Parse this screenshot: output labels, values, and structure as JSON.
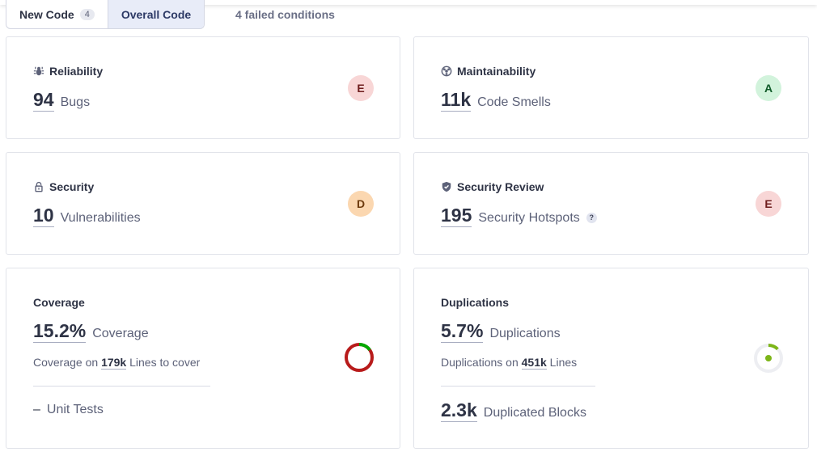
{
  "tabs": {
    "new_code_label": "New Code",
    "new_code_count": "4",
    "overall_code_label": "Overall Code",
    "active": "Overall Code"
  },
  "failed_conditions": "4 failed conditions",
  "reliability": {
    "title": "Reliability",
    "value": "94",
    "label": "Bugs",
    "grade": "E",
    "icon": "bug-icon"
  },
  "maintainability": {
    "title": "Maintainability",
    "value": "11k",
    "label": "Code Smells",
    "grade": "A",
    "icon": "maintainability-icon"
  },
  "security": {
    "title": "Security",
    "value": "10",
    "label": "Vulnerabilities",
    "grade": "D",
    "icon": "lock-icon"
  },
  "security_review": {
    "title": "Security Review",
    "value": "195",
    "label": "Security Hotspots",
    "grade": "E",
    "help": "?",
    "icon": "shield-icon"
  },
  "coverage": {
    "title": "Coverage",
    "value": "15.2%",
    "label": "Coverage",
    "sub_prefix": "Coverage on",
    "sub_value": "179k",
    "sub_suffix": "Lines to cover",
    "unit_dash": "–",
    "unit_label": "Unit Tests",
    "percent": 15.2
  },
  "duplications": {
    "title": "Duplications",
    "value": "5.7%",
    "label": "Duplications",
    "sub_prefix": "Duplications on",
    "sub_value": "451k",
    "sub_suffix": "Lines",
    "blocks_value": "2.3k",
    "blocks_label": "Duplicated Blocks",
    "percent": 5.7
  },
  "colors": {
    "grade_E": "#f8d6d6",
    "grade_D": "#fbd7b0",
    "grade_A": "#d2f3dc",
    "coverage_covered": "#00aa00",
    "coverage_uncovered": "#b81b1b",
    "duplication_arc": "#7cb518"
  }
}
